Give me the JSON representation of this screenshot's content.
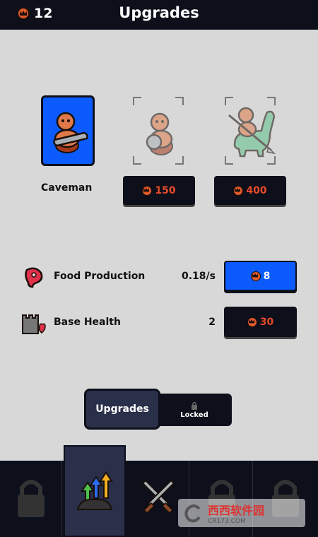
{
  "header": {
    "title": "Upgrades",
    "currency_value": "12",
    "currency_icon": "crown-coin-icon"
  },
  "units": [
    {
      "name": "Caveman",
      "state": "active"
    },
    {
      "name": "",
      "state": "locked",
      "cost": "150"
    },
    {
      "name": "",
      "state": "locked",
      "cost": "400"
    }
  ],
  "stats": [
    {
      "label": "Food Production",
      "value": "0.18/s",
      "cost": "8",
      "style": "blue"
    },
    {
      "label": "Base Health",
      "value": "2",
      "cost": "30",
      "style": "dark"
    }
  ],
  "tabs": {
    "upgrades": "Upgrades",
    "locked": "Locked"
  },
  "watermark": {
    "brand": "西西软件园",
    "site": "CR173.COM"
  },
  "colors": {
    "accent_blue": "#0b5bff",
    "dark": "#0d0f1a",
    "cost_red": "#e84a2a",
    "coin": "#e05a2b"
  }
}
